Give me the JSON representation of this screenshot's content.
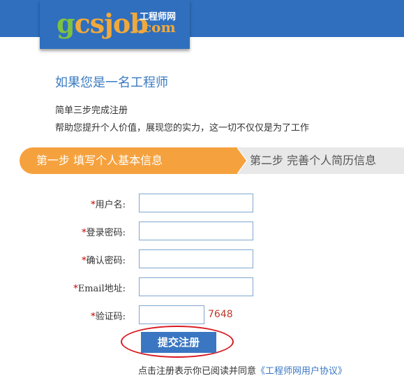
{
  "logo": {
    "g": "g",
    "c": "c",
    "s": "s",
    "job": "job",
    "cn": "工程师网",
    "com": ".com"
  },
  "intro": {
    "headline": "如果您是一名工程师",
    "line1": "简单三步完成注册",
    "line2": "帮助您提升个人价值，展现您的实力，这一切不仅仅是为了工作"
  },
  "steps": {
    "step1": "第一步 填写个人基本信息",
    "step2": "第二步 完善个人简历信息"
  },
  "form": {
    "required_mark": "*",
    "username_label": "用户名:",
    "password_label": "登录密码:",
    "confirm_label": "确认密码:",
    "email_label": "Email地址:",
    "captcha_label": "验证码:",
    "username_value": "",
    "password_value": "",
    "confirm_value": "",
    "email_value": "",
    "captcha_value": "",
    "captcha_code": "7648",
    "submit_label": "提交注册"
  },
  "agreement": {
    "text": "点击注册表示你已阅读并同意",
    "link": "《工程师网用户协议》"
  },
  "colors": {
    "header_blue": "#2f6fbe",
    "accent_orange": "#f5a23e",
    "highlight_red": "#d7191f"
  }
}
